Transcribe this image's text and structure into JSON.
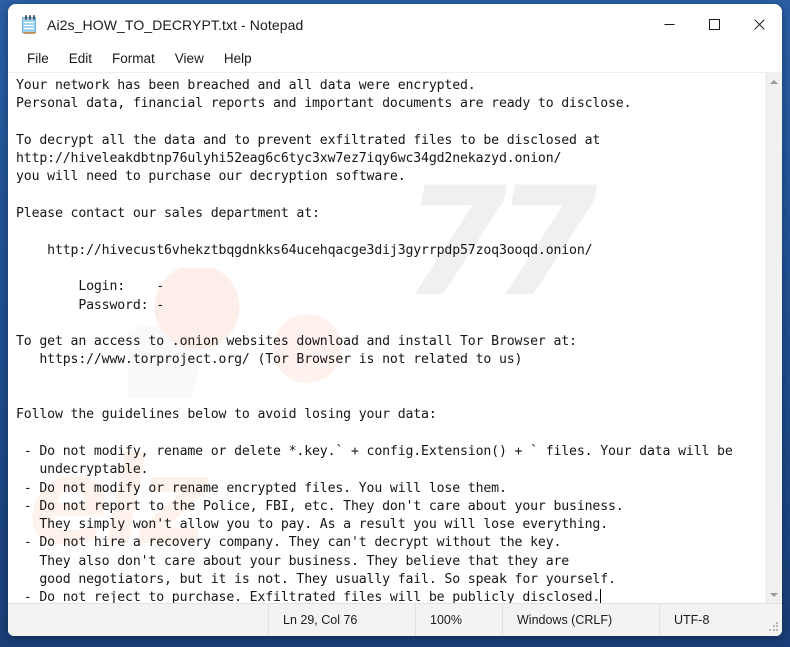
{
  "window": {
    "title": "Ai2s_HOW_TO_DECRYPT.txt - Notepad",
    "icon": "notepad-icon",
    "controls": {
      "minimize": "Minimize",
      "maximize": "Maximize",
      "close": "Close"
    }
  },
  "menu": {
    "items": [
      {
        "label": "File"
      },
      {
        "label": "Edit"
      },
      {
        "label": "Format"
      },
      {
        "label": "View"
      },
      {
        "label": "Help"
      }
    ]
  },
  "document": {
    "text": "Your network has been breached and all data were encrypted.\nPersonal data, financial reports and important documents are ready to disclose.\n\nTo decrypt all the data and to prevent exfiltrated files to be disclosed at\nhttp://hiveleakdbtnp76ulyhi52eag6c6tyc3xw7ez7iqy6wc34gd2nekazyd.onion/\nyou will need to purchase our decryption software.\n\nPlease contact our sales department at:\n\n    http://hivecust6vhekztbqgdnkks64ucehqacge3dij3gyrrpdp57zoq3ooqd.onion/\n\n        Login:    -\n        Password: -\n\nTo get an access to .onion websites download and install Tor Browser at:\n   https://www.torproject.org/ (Tor Browser is not related to us)\n\n\nFollow the guidelines below to avoid losing your data:\n\n - Do not modify, rename or delete *.key.` + config.Extension() + ` files. Your data will be\n   undecryptable.\n - Do not modify or rename encrypted files. You will lose them.\n - Do not report to the Police, FBI, etc. They don't care about your business.\n   They simply won't allow you to pay. As a result you will lose everything.\n - Do not hire a recovery company. They can't decrypt without the key.\n   They also don't care about your business. They believe that they are\n   good negotiators, but it is not. They usually fail. So speak for yourself.\n - Do not reject to purchase. Exfiltrated files will be publicly disclosed."
  },
  "scrollbar": {
    "up_arrow": "scroll-up",
    "down_arrow": "scroll-down"
  },
  "statusbar": {
    "position": "Ln 29, Col 76",
    "zoom": "100%",
    "line_ending": "Windows (CRLF)",
    "encoding": "UTF-8"
  },
  "watermarks": {
    "grey": "77",
    "pink": "elz"
  },
  "colors": {
    "desktop": "#1f4e8f",
    "window_bg": "#f3f3f3",
    "editor_bg": "#ffffff",
    "text": "#161616",
    "close_hover": "#e81123"
  }
}
